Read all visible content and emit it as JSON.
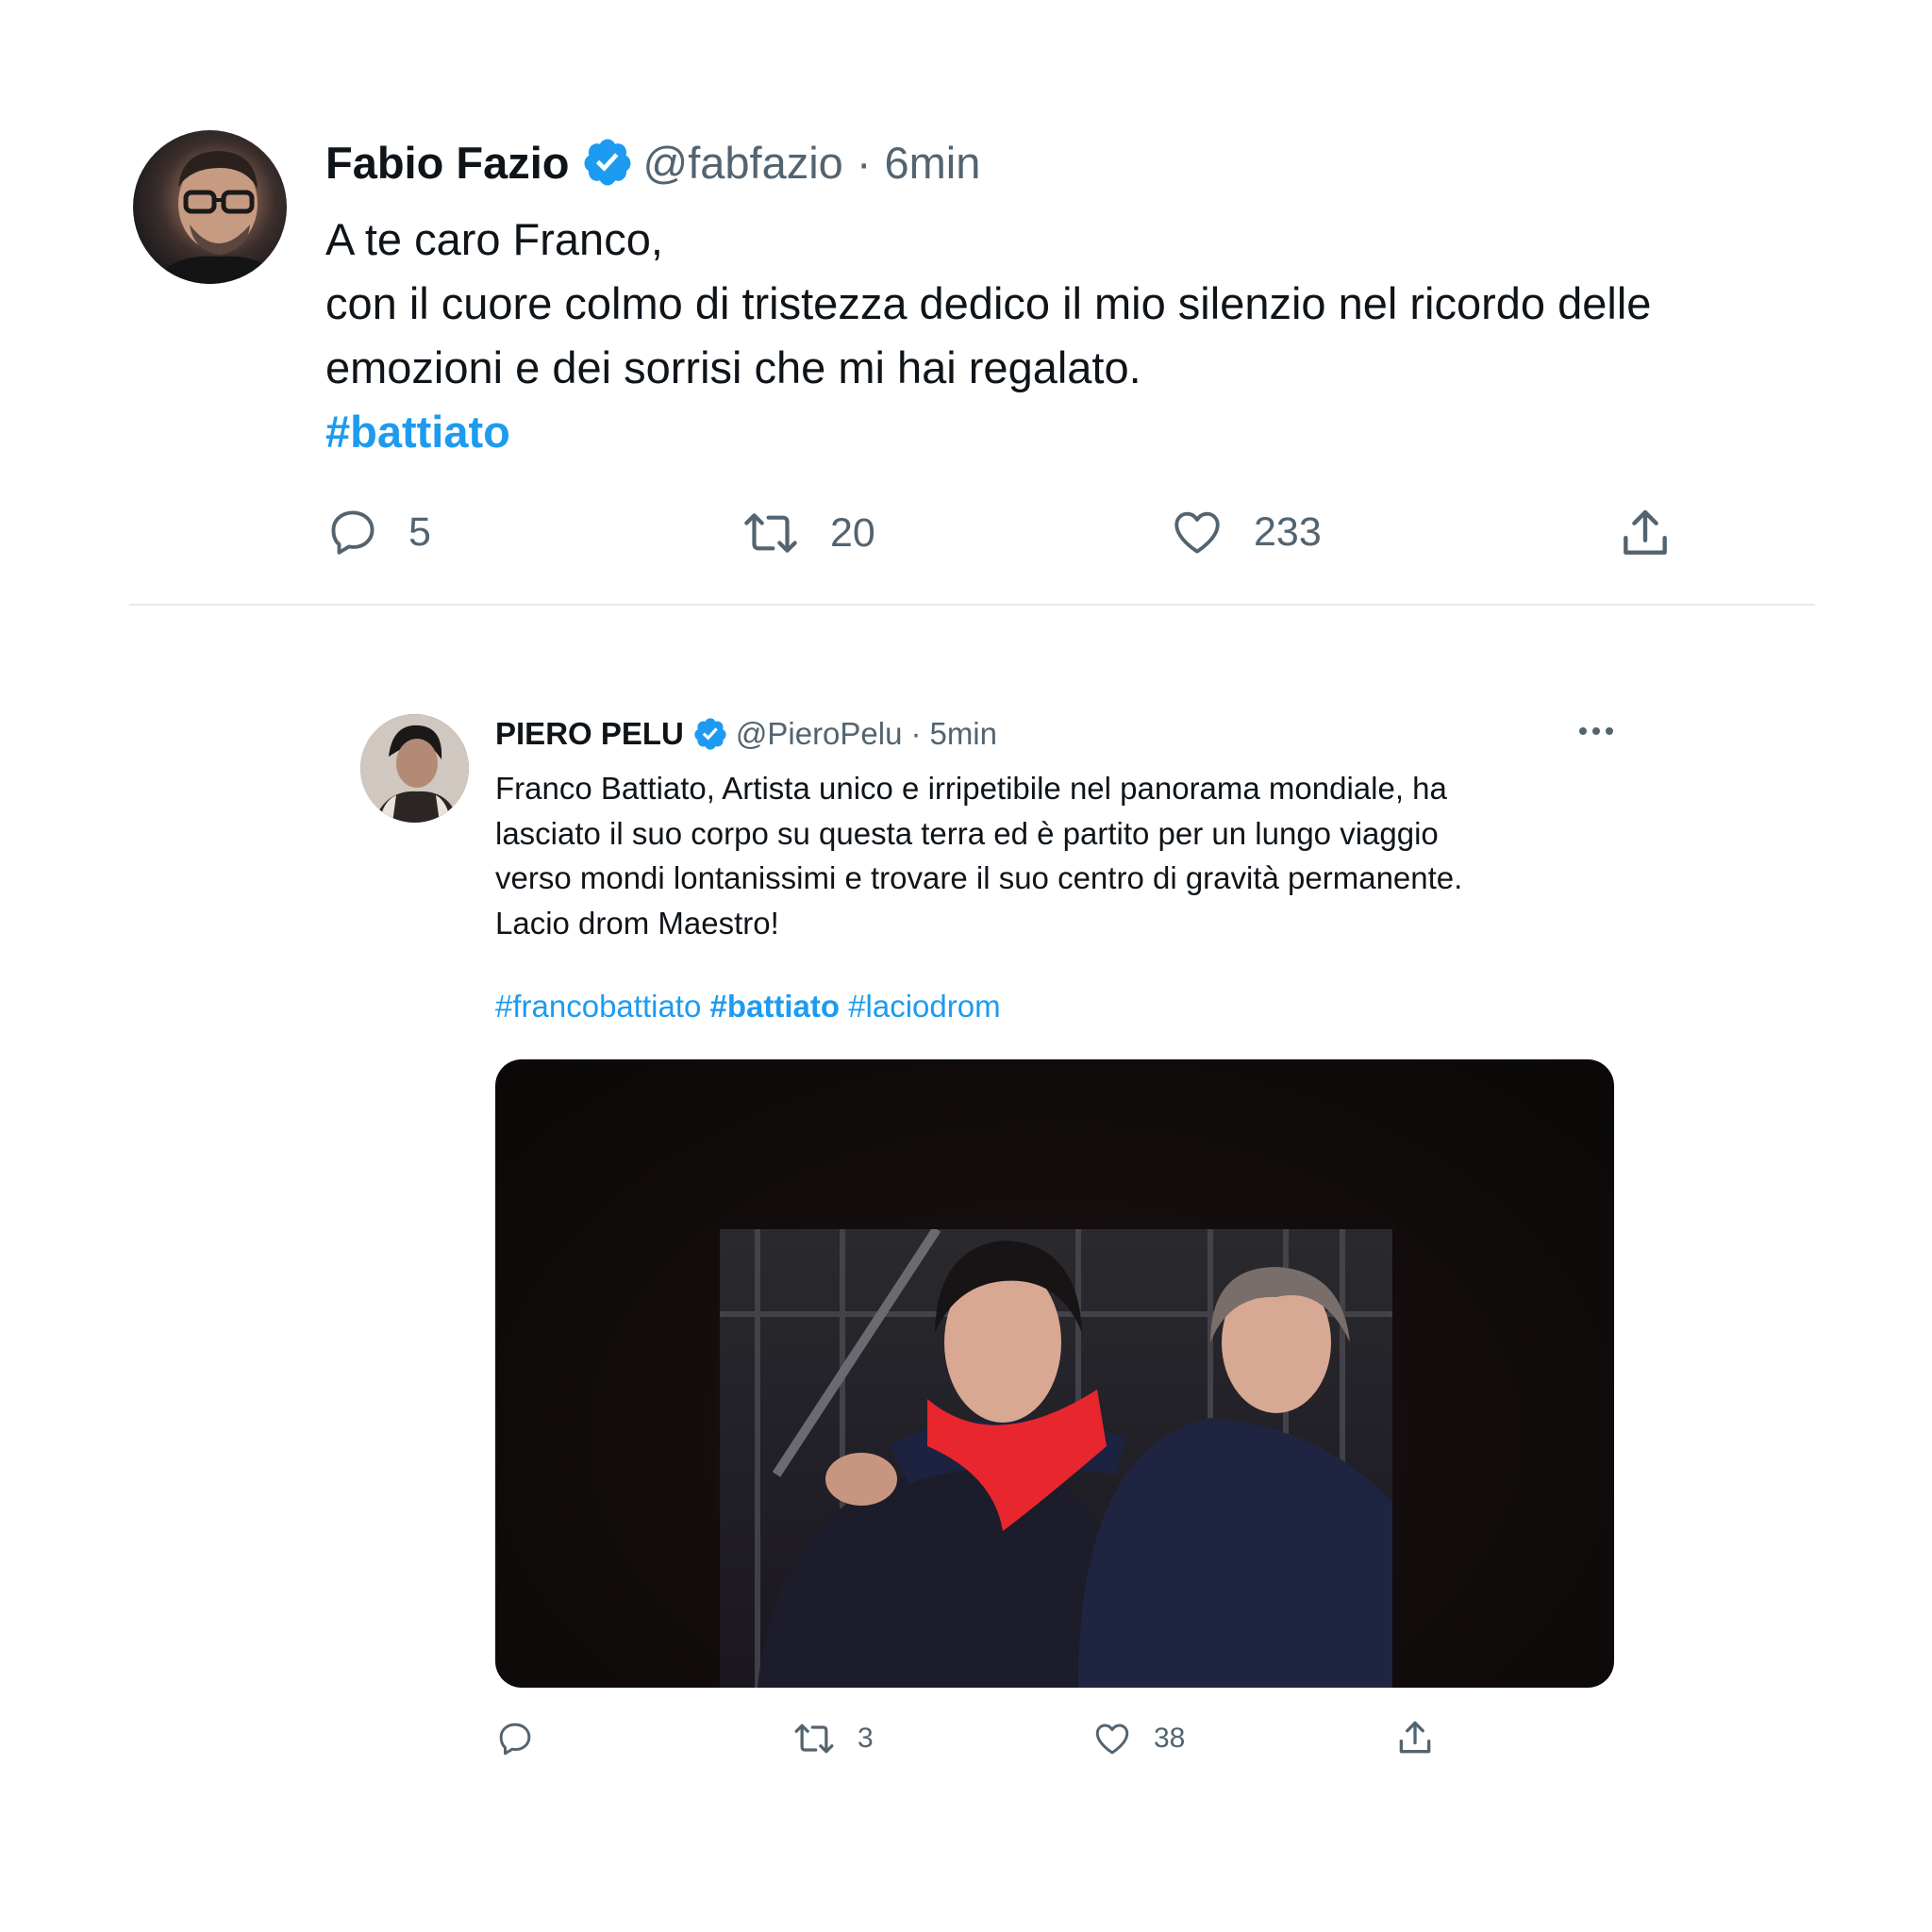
{
  "tweets": [
    {
      "name": "Fabio Fazio",
      "handle": "@fabfazio",
      "separator": "·",
      "time": "6min",
      "body_lines": [
        "A te caro Franco,",
        "con il cuore colmo di tristezza dedico il mio silenzio nel ricordo delle",
        "emozioni e dei sorrisi che mi hai regalato."
      ],
      "hashtag": "#battiato",
      "actions": {
        "reply_count": "5",
        "retweet_count": "20",
        "like_count": "233"
      }
    },
    {
      "name": "PIERO PELU",
      "handle": "@PieroPelu",
      "separator": "·",
      "time": "5min",
      "body_lines": [
        "Franco Battiato, Artista unico e irripetibile nel panorama mondiale, ha",
        "lasciato il suo corpo su questa terra ed è partito per un lungo viaggio",
        "verso mondi lontanissimi e trovare il suo centro di gravità permanente.",
        "Lacio drom Maestro!"
      ],
      "hashtags": [
        "#francobattiato",
        "#battiato",
        "#laciodrom"
      ],
      "actions": {
        "retweet_count": "3",
        "like_count": "38"
      }
    }
  ],
  "icons": {
    "verified": "verified-badge-icon",
    "reply": "reply-icon",
    "retweet": "retweet-icon",
    "like": "heart-icon",
    "share": "share-icon",
    "more": "more-options-icon"
  },
  "colors": {
    "accent": "#1d9bf0",
    "text": "#0f1419",
    "secondary": "#536471",
    "divider": "#e6e9eb",
    "scarf": "#e8262e"
  }
}
